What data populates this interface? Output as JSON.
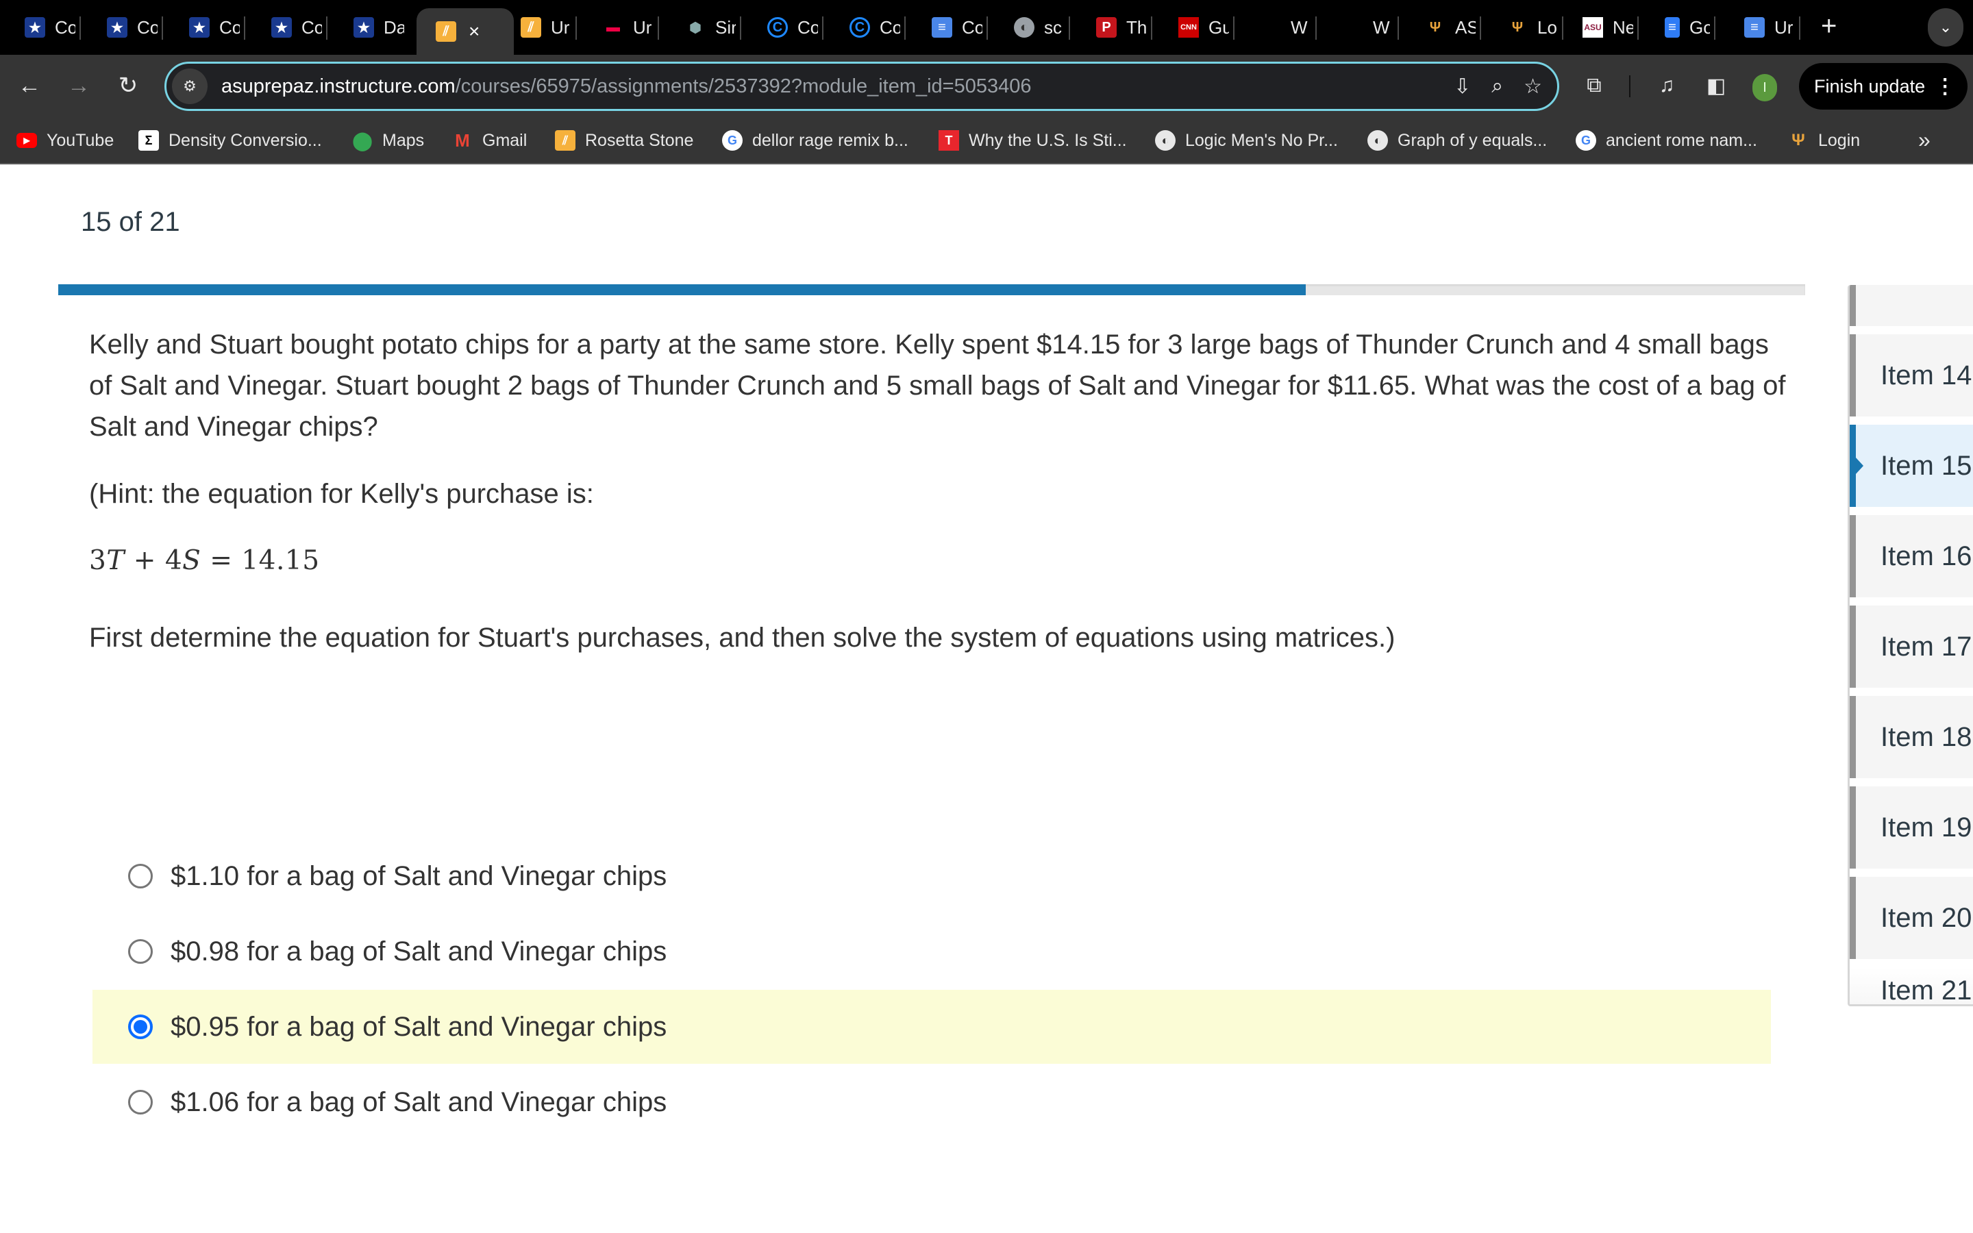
{
  "browser": {
    "tabs": [
      {
        "title": "Co",
        "icon": "canvas-star-icon"
      },
      {
        "title": "Co",
        "icon": "canvas-star-icon"
      },
      {
        "title": "Co",
        "icon": "canvas-star-icon"
      },
      {
        "title": "Co",
        "icon": "canvas-star-icon"
      },
      {
        "title": "Da",
        "icon": "canvas-star-icon"
      },
      {
        "title": "",
        "icon": "rosetta-stone-icon",
        "active": true,
        "close": "×"
      },
      {
        "title": "Ur",
        "icon": "rosetta-stone-icon"
      },
      {
        "title": "Ur",
        "icon": "rainbow-icon"
      },
      {
        "title": "Sir",
        "icon": "cubes-icon"
      },
      {
        "title": "Co",
        "icon": "c-circle-icon"
      },
      {
        "title": "Co",
        "icon": "c-circle-icon"
      },
      {
        "title": "Co",
        "icon": "google-docs-icon"
      },
      {
        "title": "sc",
        "icon": "globe-icon"
      },
      {
        "title": "Th",
        "icon": "p-red-icon"
      },
      {
        "title": "Gu",
        "icon": "cnn-icon"
      },
      {
        "title": "W",
        "icon": ""
      },
      {
        "title": "W",
        "icon": ""
      },
      {
        "title": "AS",
        "icon": "pitchfork-icon"
      },
      {
        "title": "Lo",
        "icon": "pitchfork-icon"
      },
      {
        "title": "Ne",
        "icon": "asu-icon"
      },
      {
        "title": "Go",
        "icon": "google-docs-file-icon"
      },
      {
        "title": "Ur",
        "icon": "google-docs-icon"
      }
    ],
    "new_tab": "+",
    "tab_search": "⌄",
    "url_host": "asuprepaz.instructure.com",
    "url_path": "/courses/65975/assignments/2537392?module_item_id=5053406",
    "profile_initial": "I",
    "finish_update_label": "Finish update",
    "bookmarks": [
      {
        "label": "YouTube",
        "icon": "youtube-icon"
      },
      {
        "label": "Density Conversio...",
        "icon": "sigma-icon"
      },
      {
        "label": "Maps",
        "icon": "maps-pin-icon"
      },
      {
        "label": "Gmail",
        "icon": "gmail-icon"
      },
      {
        "label": "Rosetta Stone",
        "icon": "rosetta-stone-icon"
      },
      {
        "label": "dellor rage remix b...",
        "icon": "google-icon"
      },
      {
        "label": "Why the U.S. Is Sti...",
        "icon": "t-red-icon"
      },
      {
        "label": "Logic Men's No Pr...",
        "icon": "globe-icon"
      },
      {
        "label": "Graph of y equals...",
        "icon": "globe-icon"
      },
      {
        "label": "ancient rome nam...",
        "icon": "google-icon"
      },
      {
        "label": "Login",
        "icon": "pitchfork-icon"
      }
    ],
    "bookmarks_overflow": "»"
  },
  "quiz": {
    "counter": "15 of 21",
    "progress": {
      "current": 15,
      "total": 21,
      "fraction": 0.714
    },
    "accent_color": "#1a77b0",
    "question": {
      "stem": "Kelly and Stuart bought potato chips for a party at the same store. Kelly spent $14.15 for 3 large bags of Thunder Crunch and 4 small bags of Salt and Vinegar. Stuart bought 2 bags of Thunder Crunch and 5 small bags of Salt and Vinegar for $11.65. What was the cost of a bag of Salt and Vinegar chips?",
      "hint": "(Hint: the equation for Kelly's purchase is:",
      "equation": {
        "a": "3",
        "var1": "T",
        "op": " + ",
        "b": "4",
        "var2": "S",
        "eq": " = ",
        "rhs": "14.15"
      },
      "instruction": "First determine the equation for Stuart's purchases, and then solve the system of equations using matrices.)"
    },
    "answers": [
      {
        "label": "$1.10 for a bag of Salt and Vinegar chips",
        "selected": false
      },
      {
        "label": "$0.98 for a bag of Salt and Vinegar chips",
        "selected": false
      },
      {
        "label": "$0.95 for a bag of Salt and Vinegar chips",
        "selected": true
      },
      {
        "label": "$1.06 for a bag of Salt and Vinegar chips",
        "selected": false
      }
    ],
    "navigator": {
      "items": [
        {
          "label": "",
          "partial": true
        },
        {
          "label": "Item 14"
        },
        {
          "label": "Item 15",
          "current": true
        },
        {
          "label": "Item 16"
        },
        {
          "label": "Item 17"
        },
        {
          "label": "Item 18"
        },
        {
          "label": "Item 19"
        },
        {
          "label": "Item 20"
        },
        {
          "label": "Item 21"
        }
      ]
    }
  }
}
